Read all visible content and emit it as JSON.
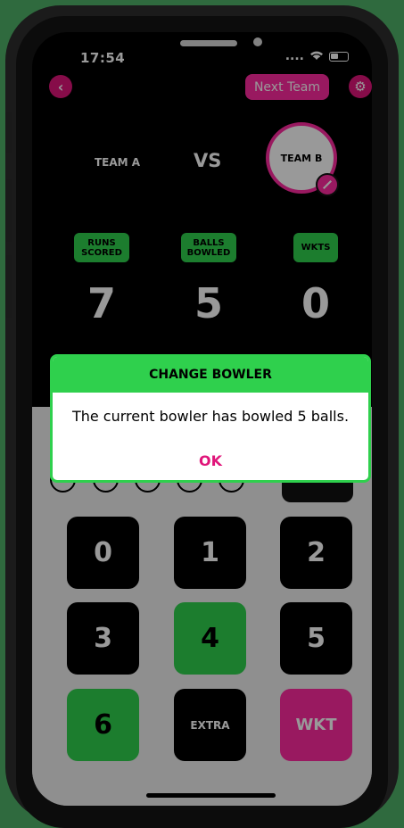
{
  "status_bar": {
    "time": "17:54",
    "signal": "....",
    "wifi_icon": "wifi-icon",
    "battery_icon": "battery-icon"
  },
  "header": {
    "back_icon": "chevron-left-icon",
    "next_team_label": "Next Team",
    "settings_icon": "gear-icon"
  },
  "teams": {
    "team_a": "TEAM A",
    "vs": "VS",
    "team_b": "TEAM B",
    "batting_icon": "cricket-bat-icon"
  },
  "stats": [
    {
      "label": "RUNS\nSCORED",
      "value": "7"
    },
    {
      "label": "BALLS\nBOWLED",
      "value": "5"
    },
    {
      "label": "WKTS",
      "value": "0"
    }
  ],
  "keypad": [
    {
      "label": "0",
      "style": "black"
    },
    {
      "label": "1",
      "style": "black"
    },
    {
      "label": "2",
      "style": "black"
    },
    {
      "label": "3",
      "style": "black"
    },
    {
      "label": "4",
      "style": "green"
    },
    {
      "label": "5",
      "style": "black"
    },
    {
      "label": "6",
      "style": "green"
    },
    {
      "label": "EXTRA",
      "style": "black"
    },
    {
      "label": "WKT",
      "style": "pink"
    }
  ],
  "dialog": {
    "title": "CHANGE BOWLER",
    "message": "The current bowler has bowled 5 balls.",
    "ok_label": "OK"
  },
  "colors": {
    "accent_pink": "#ff2aa0",
    "accent_green": "#2fd04d",
    "background_green": "#2f6a3e"
  }
}
